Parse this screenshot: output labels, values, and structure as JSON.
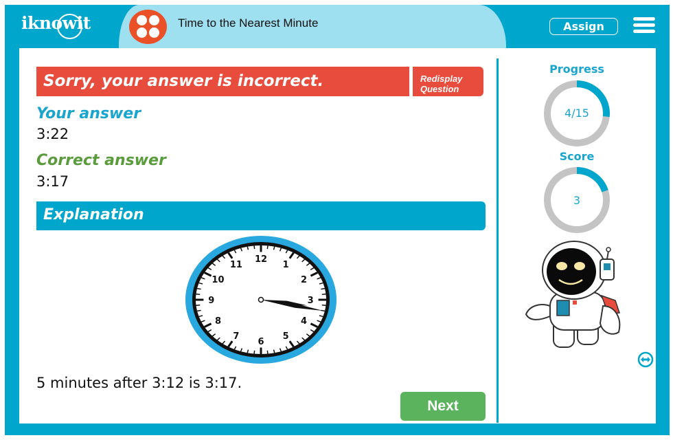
{
  "header": {
    "logo": "iknowit",
    "title": "Time to the Nearest Minute",
    "assign_label": "Assign",
    "app_icon": "four-dots-icon",
    "menu_icon": "hamburger-menu-icon"
  },
  "feedback": {
    "message": "Sorry, your answer is incorrect.",
    "redisplay_line1": "Redisplay",
    "redisplay_line2": "Question",
    "your_answer_label": "Your answer",
    "your_answer_value": "3:22",
    "correct_answer_label": "Correct answer",
    "correct_answer_value": "3:17"
  },
  "explanation": {
    "heading": "Explanation",
    "clock": {
      "numbers": [
        "12",
        "1",
        "2",
        "3",
        "4",
        "5",
        "6",
        "7",
        "8",
        "9",
        "10",
        "11"
      ],
      "hour": 3,
      "minute": 17
    },
    "text": "5 minutes after 3:12 is 3:17."
  },
  "next_label": "Next",
  "sidebar": {
    "progress": {
      "label": "Progress",
      "text": "4/15",
      "fraction": 0.2667
    },
    "score": {
      "label": "Score",
      "text": "3",
      "fraction": 0.2
    },
    "mascot": "astronaut-robot",
    "expand_icon": "expand-arrows-icon"
  },
  "colors": {
    "brand_blue": "#00a6cc",
    "light_blue": "#9edff0",
    "error_red": "#e84c3d",
    "correct_green": "#5a9c3c",
    "next_green": "#5bb35d",
    "ring_gray": "#c4c4c4"
  }
}
